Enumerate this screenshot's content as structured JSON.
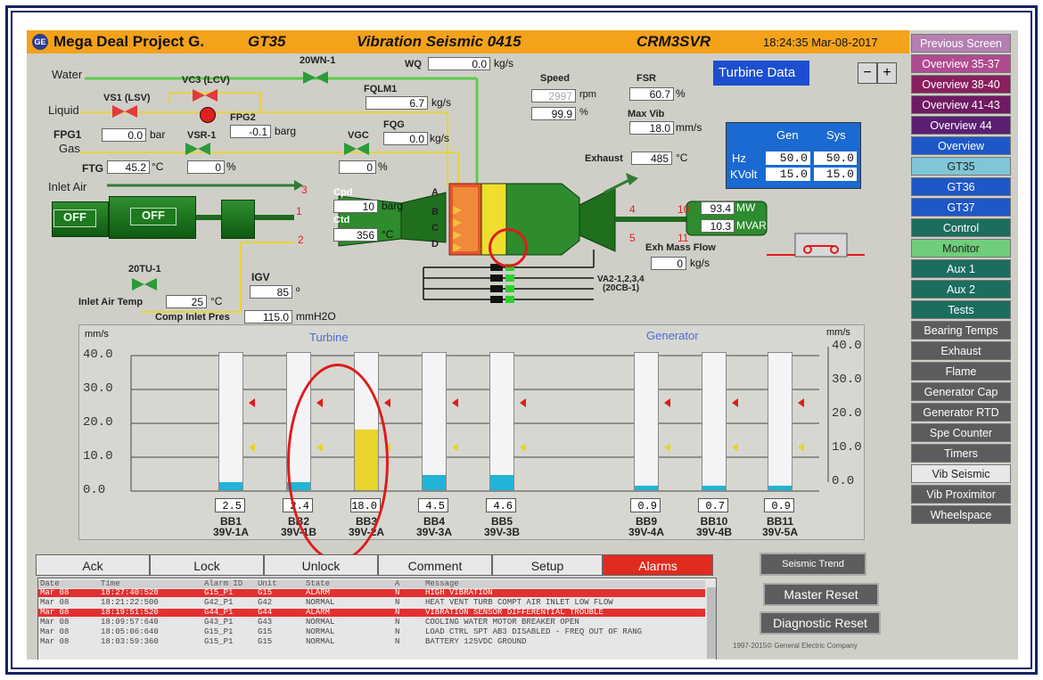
{
  "header": {
    "project": "Mega Deal Project G.",
    "unit": "GT35",
    "screen": "Vibration Seismic 0415",
    "server": "CRM3SVR",
    "datetime": "18:24:35 Mar-08-2017",
    "logo": "GE"
  },
  "turbine_data": {
    "label": "Turbine Data",
    "minus": "−",
    "plus": "+"
  },
  "flow": {
    "water_label": "Water",
    "liquid_label": "Liquid",
    "gas_label": "Gas",
    "inlet_air_label": "Inlet Air",
    "wn_label": "20WN-1",
    "wq_label": "WQ",
    "wq_value": "0.0",
    "wq_unit": "kg/s",
    "vc3_label": "VC3 (LCV)",
    "vs1_label": "VS1 (LSV)",
    "fqlm1_label": "FQLM1",
    "fqlm1_value": "6.7",
    "fqlm1_unit": "kg/s",
    "fpg2_label": "FPG2",
    "fpg2_value": "-0.1",
    "fpg2_unit": "barg",
    "fpg1_label": "FPG1",
    "fpg1_value": "0.0",
    "fpg1_unit": "bar",
    "vsr1_label": "VSR-1",
    "vsr1_value": "0",
    "vsr1_unit": "%",
    "vgc_label": "VGC",
    "vgc_value": "0",
    "vgc_unit": "%",
    "fqg_label": "FQG",
    "fqg_value": "0.0",
    "fqg_unit": "kg/s",
    "ftg_label": "FTG",
    "ftg_value": "45.2",
    "ftg_unit": "°C",
    "speed_label": "Speed",
    "speed_rpm": "2997",
    "speed_rpm_unit": "rpm",
    "speed_pct": "99.9",
    "speed_pct_unit": "%",
    "fsr_label": "FSR",
    "fsr_value": "60.7",
    "fsr_unit": "%",
    "maxvib_label": "Max Vib",
    "maxvib_value": "18.0",
    "maxvib_unit": "mm/s",
    "exhaust_label": "Exhaust",
    "exhaust_value": "485",
    "exhaust_unit": "°C",
    "cpd_label": "Cpd",
    "cpd_value": "10",
    "cpd_unit": "barg",
    "ctd_label": "Ctd",
    "ctd_value": "356",
    "ctd_unit": "°C",
    "mw_value": "93.4",
    "mw_unit": "MW",
    "mvar_value": "10.3",
    "mvar_unit": "MVAR",
    "exh_mass_label": "Exh Mass Flow",
    "exh_mass_value": "0",
    "exh_mass_unit": "kg/s",
    "va_label": "VA2-1,2,3,4",
    "va_sub": "(20CB-1)",
    "tu_label": "20TU-1",
    "igv_label": "IGV",
    "igv_value": "85",
    "igv_unit": "º",
    "inlet_temp_label": "Inlet Air Temp",
    "inlet_temp_value": "25",
    "inlet_temp_unit": "°C",
    "comp_inlet_label": "Comp Inlet Pres",
    "comp_inlet_value": "115.0",
    "comp_inlet_unit": "mmH2O",
    "off1": "OFF",
    "off2": "OFF",
    "row_a": "A",
    "row_b": "B",
    "row_c": "C",
    "row_d": "D",
    "n1": "1",
    "n2": "2",
    "n3": "3",
    "n4": "4",
    "n5": "5",
    "n10": "10",
    "n11": "11"
  },
  "gensys": {
    "gen_label": "Gen",
    "sys_label": "Sys",
    "hz_label": "Hz",
    "kvolt_label": "KVolt",
    "hz_gen": "50.0",
    "hz_sys": "50.0",
    "kv_gen": "15.0",
    "kv_sys": "15.0"
  },
  "chart_data": {
    "type": "bar",
    "left_unit": "mm/s",
    "right_unit": "mm/s",
    "turbine_label": "Turbine",
    "generator_label": "Generator",
    "ylim": [
      0,
      40
    ],
    "left_ticks": [
      "40.0",
      "30.0",
      "20.0",
      "10.0",
      "0.0"
    ],
    "right_ticks": [
      "40.0",
      "30.0",
      "20.0",
      "10.0",
      "0.0"
    ],
    "alarm_level": 26,
    "alert_level": 13,
    "bars": [
      {
        "name": "BB1",
        "tag": "39V-1A",
        "value": 2.5,
        "label": "2.5",
        "color": "#22b4d6"
      },
      {
        "name": "BB2",
        "tag": "39V-1B",
        "value": 2.4,
        "label": "2.4",
        "color": "#22b4d6"
      },
      {
        "name": "BB3",
        "tag": "39V-2A",
        "value": 18.0,
        "label": "18.0",
        "color": "#e8d42a"
      },
      {
        "name": "BB4",
        "tag": "39V-3A",
        "value": 4.5,
        "label": "4.5",
        "color": "#22b4d6"
      },
      {
        "name": "BB5",
        "tag": "39V-3B",
        "value": 4.6,
        "label": "4.6",
        "color": "#22b4d6"
      },
      {
        "name": "BB9",
        "tag": "39V-4A",
        "value": 0.9,
        "label": "0.9",
        "color": "#22b4d6"
      },
      {
        "name": "BB10",
        "tag": "39V-4B",
        "value": 0.7,
        "label": "0.7",
        "color": "#22b4d6"
      },
      {
        "name": "BB11",
        "tag": "39V-5A",
        "value": 0.9,
        "label": "0.9",
        "color": "#22b4d6"
      }
    ]
  },
  "sidebar": {
    "items": [
      {
        "label": "Previous Screen",
        "bg": "#b57fb2"
      },
      {
        "label": "Overview 35-37",
        "bg": "#b04b8f"
      },
      {
        "label": "Overview 38-40",
        "bg": "#8a1f5f"
      },
      {
        "label": "Overview 41-43",
        "bg": "#6f1a63"
      },
      {
        "label": "Overview 44",
        "bg": "#5a1f72"
      },
      {
        "label": "Overview",
        "bg": "#1d57c8"
      },
      {
        "label": "GT35",
        "bg": "#7fc6d8"
      },
      {
        "label": "GT36",
        "bg": "#1d57c8"
      },
      {
        "label": "GT37",
        "bg": "#1d57c8"
      },
      {
        "label": "Control",
        "bg": "#1b6d5f"
      },
      {
        "label": "Monitor",
        "bg": "#6fce7a"
      },
      {
        "label": "Aux 1",
        "bg": "#1b6d5f"
      },
      {
        "label": "Aux 2",
        "bg": "#1b6d5f"
      },
      {
        "label": "Tests",
        "bg": "#1b6d5f"
      },
      {
        "label": "Bearing Temps",
        "bg": "#5c5c5c"
      },
      {
        "label": "Exhaust",
        "bg": "#5c5c5c"
      },
      {
        "label": "Flame",
        "bg": "#5c5c5c"
      },
      {
        "label": "Generator Cap",
        "bg": "#5c5c5c"
      },
      {
        "label": "Generator RTD",
        "bg": "#5c5c5c"
      },
      {
        "label": "Spe Counter",
        "bg": "#5c5c5c"
      },
      {
        "label": "Timers",
        "bg": "#5c5c5c"
      },
      {
        "label": "Vib Seismic",
        "bg": "#e8e8e8"
      },
      {
        "label": "Vib Proximitor",
        "bg": "#5c5c5c"
      },
      {
        "label": "Wheelspace",
        "bg": "#5c5c5c"
      }
    ]
  },
  "tabs": [
    "Ack",
    "Lock",
    "Unlock",
    "Comment",
    "Setup",
    "Alarms"
  ],
  "alarm_header": {
    "date": "Date",
    "time": "Time",
    "id": "Alarm ID",
    "unit": "Unit",
    "state": "State",
    "a": "A",
    "msg": "Message"
  },
  "alarms": [
    {
      "date": "Mar 08",
      "time": "18:27:40:520",
      "id": "G15_P1",
      "unit": "G15",
      "state": "ALARM",
      "a": "N",
      "msg": "HIGH VIBRATION",
      "red": true
    },
    {
      "date": "Mar 08",
      "time": "18:21:22:500",
      "id": "G42_P1",
      "unit": "G42",
      "state": "NORMAL",
      "a": "N",
      "msg": "HEAT VENT TURB COMPT AIR INLET LOW FLOW",
      "red": false
    },
    {
      "date": "Mar 08",
      "time": "18:19:51:520",
      "id": "G44_P1",
      "unit": "G44",
      "state": "ALARM",
      "a": "N",
      "msg": "VIBRATION SENSOR DIFFERENTIAL TROUBLE",
      "red": true
    },
    {
      "date": "Mar 08",
      "time": "18:09:57:640",
      "id": "G43_P1",
      "unit": "G43",
      "state": "NORMAL",
      "a": "N",
      "msg": "COOLING WATER MOTOR BREAKER OPEN",
      "red": false
    },
    {
      "date": "Mar 08",
      "time": "18:05:06:640",
      "id": "G15_P1",
      "unit": "G15",
      "state": "NORMAL",
      "a": "N",
      "msg": "LOAD CTRL SPT AB3 DISABLED - FREQ OUT OF RANG",
      "red": false
    },
    {
      "date": "Mar 08",
      "time": "18:03:59:360",
      "id": "G15_P1",
      "unit": "G15",
      "state": "NORMAL",
      "a": "N",
      "msg": "BATTERY 125VDC GROUND",
      "red": false
    }
  ],
  "actions": {
    "seismic_trend": "Seismic Trend",
    "master_reset": "Master Reset",
    "diagnostic_reset": "Diagnostic Reset",
    "copyright": "1997-2015© General Electric Company"
  }
}
